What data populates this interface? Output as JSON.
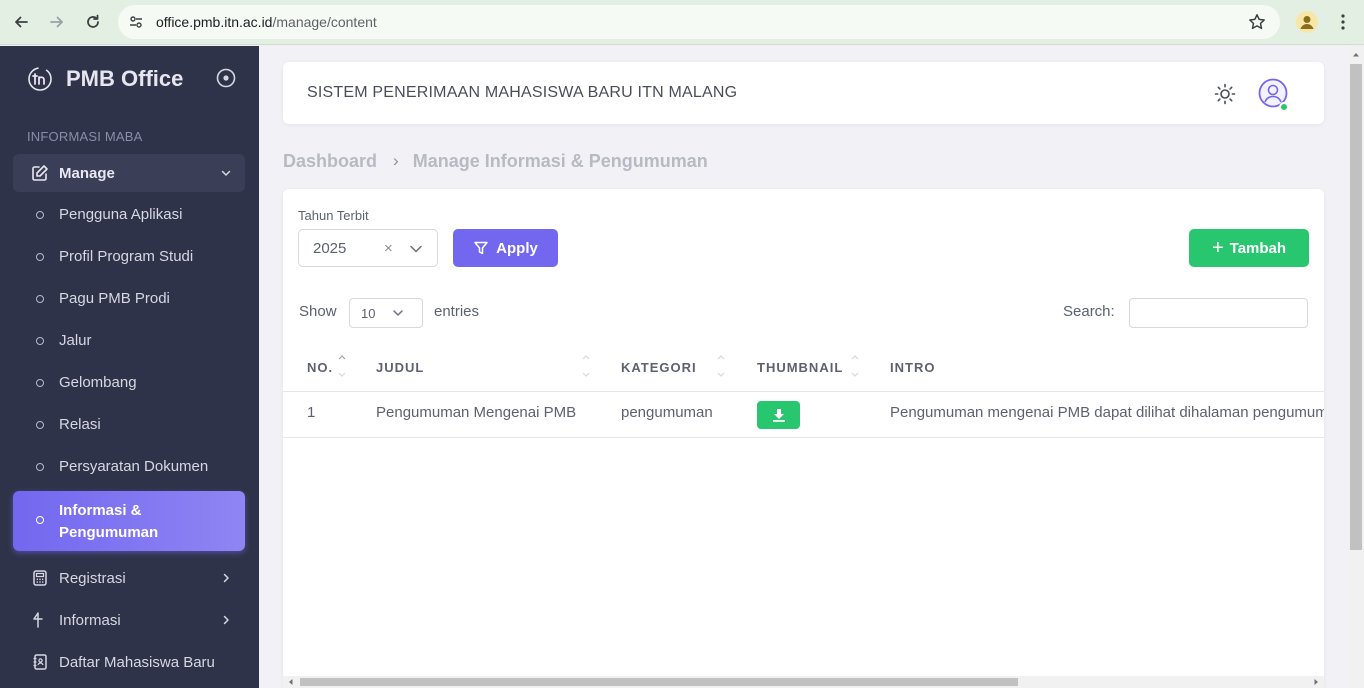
{
  "browser": {
    "url_host": "office.pmb.itn.ac.id",
    "url_path": "/manage/content"
  },
  "sidebar": {
    "brand": "PMB Office",
    "section_title": "INFORMASI MABA",
    "manage_label": "Manage",
    "sub_items": [
      "Pengguna Aplikasi",
      "Profil Program Studi",
      "Pagu PMB Prodi",
      "Jalur",
      "Gelombang",
      "Relasi",
      "Persyaratan Dokumen"
    ],
    "active_item": "Informasi & Pengumuman",
    "menu_items": [
      {
        "label": "Registrasi",
        "icon": "calculator-icon"
      },
      {
        "label": "Informasi",
        "icon": "flag-icon"
      },
      {
        "label": "Daftar Mahasiswa Baru",
        "icon": "address-book-icon"
      }
    ]
  },
  "header": {
    "title": "SISTEM PENERIMAAN MAHASISWA BARU ITN MALANG"
  },
  "breadcrumb": {
    "home": "Dashboard",
    "current": "Manage Informasi & Pengumuman"
  },
  "filter": {
    "label": "Tahun Terbit",
    "year": "2025",
    "clear": "×",
    "apply_label": "Apply",
    "add_label": "Tambah"
  },
  "table_controls": {
    "show_label": "Show",
    "entries_value": "10",
    "entries_label": "entries",
    "search_label": "Search:",
    "search_value": ""
  },
  "table": {
    "columns": [
      "NO.",
      "JUDUL",
      "KATEGORI",
      "THUMBNAIL",
      "INTRO"
    ],
    "rows": [
      {
        "no": "1",
        "judul": "Pengumuman Mengenai PMB",
        "kategori": "pengumuman",
        "intro": "Pengumuman mengenai PMB dapat dilihat dihalaman pengumuman"
      }
    ]
  },
  "colors": {
    "sidebar_bg": "#2f3349",
    "primary": "#7367f0",
    "success": "#28c76f"
  }
}
